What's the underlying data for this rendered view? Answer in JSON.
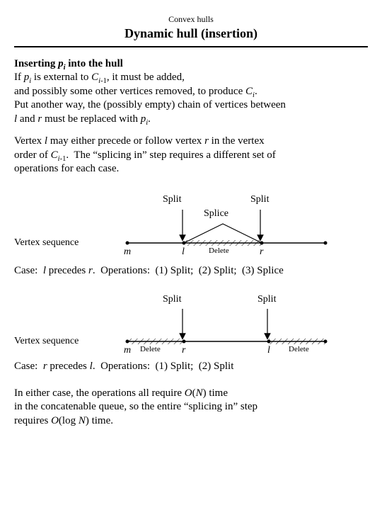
{
  "supertitle": "Convex hulls",
  "title": "Dynamic hull (insertion)",
  "heading_html": "Inserting <span class=\"ital\">p</span><sub><span class=\"ital\">i</span></sub> into the hull",
  "para1_html": "If <span class=\"ital\">p<sub>i</sub></span> is external to <span class=\"ital\">C<sub>i</sub></span><sub>-1</sub>, it must be added,<br>and possibly some other vertices removed, to produce <span class=\"ital\">C<sub>i</sub></span>.<br>Put another way, the (possibly empty) chain of vertices between<br><span class=\"ital\">l</span> and <span class=\"ital\">r</span> must be replaced with <span class=\"ital\">p<sub>i</sub></span>.",
  "para2_html": "Vertex <span class=\"ital\">l</span> may either precede or follow vertex <span class=\"ital\">r</span> in the vertex<br>order of <span class=\"ital\">C<sub>i</sub></span><sub>-1</sub>.&nbsp; The &ldquo;splicing in&rdquo; step requires a different set of<br>operations for each case.",
  "fig1": {
    "split_left": "Split",
    "split_right": "Split",
    "splice": "Splice",
    "vertex_seq": "Vertex sequence",
    "m": "m",
    "l": "l",
    "delete": "Delete",
    "r": "r"
  },
  "case1_html": "Case: &nbsp;<span class=\"ital\">l</span> precedes <span class=\"ital\">r</span>.&nbsp; Operations: &nbsp;(1) Split; &nbsp;(2) Split; &nbsp;(3) Splice",
  "fig2": {
    "split_left": "Split",
    "split_right": "Split",
    "vertex_seq": "Vertex sequence",
    "m": "m",
    "delete_left": "Delete",
    "r": "r",
    "l": "l",
    "delete_right": "Delete"
  },
  "case2_html": "Case: &nbsp;<span class=\"ital\">r</span> precedes <span class=\"ital\">l</span>.&nbsp; Operations: &nbsp;(1) Split; &nbsp;(2) Split",
  "para3_html": "In either case, the operations all require <span class=\"ital\">O</span>(<span class=\"ital\">N</span>) time<br>in the concatenable queue, so the entire &ldquo;splicing in&rdquo; step<br>requires <span class=\"ital\">O</span>(log <span class=\"ital\">N</span>) time.",
  "chart_data": [
    {
      "type": "diagram",
      "title": "Case l precedes r — vertex-sequence splice diagram",
      "axis_points": [
        "m",
        "l",
        "r",
        "end"
      ],
      "arrows": [
        {
          "label": "Split",
          "target_between": [
            "m",
            "l"
          ],
          "pointing_at": "l"
        },
        {
          "label": "Split",
          "target_between": [
            "l",
            "r"
          ],
          "pointing_at": "r"
        }
      ],
      "splice_arc_between": [
        "l",
        "r"
      ],
      "hatched_region_between": [
        "l",
        "r"
      ],
      "region_label": "Delete"
    },
    {
      "type": "diagram",
      "title": "Case r precedes l — vertex-sequence split diagram",
      "axis_points": [
        "m",
        "r",
        "l",
        "end"
      ],
      "arrows": [
        {
          "label": "Split",
          "target_between": [
            "m",
            "r"
          ],
          "pointing_at": "r"
        },
        {
          "label": "Split",
          "target_between": [
            "r",
            "l"
          ],
          "pointing_at": "l"
        }
      ],
      "hatched_regions": [
        {
          "between": [
            "m",
            "r"
          ],
          "label": "Delete"
        },
        {
          "between": [
            "l",
            "end"
          ],
          "label": "Delete"
        }
      ]
    }
  ]
}
